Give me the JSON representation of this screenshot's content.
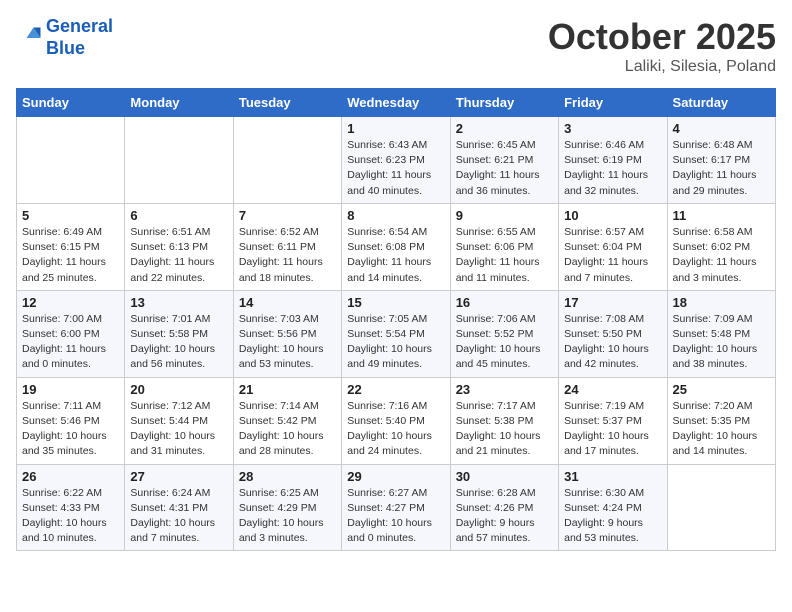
{
  "header": {
    "logo_line1": "General",
    "logo_line2": "Blue",
    "month": "October 2025",
    "location": "Laliki, Silesia, Poland"
  },
  "weekdays": [
    "Sunday",
    "Monday",
    "Tuesday",
    "Wednesday",
    "Thursday",
    "Friday",
    "Saturday"
  ],
  "weeks": [
    [
      {
        "day": "",
        "sunrise": "",
        "sunset": "",
        "daylight": ""
      },
      {
        "day": "",
        "sunrise": "",
        "sunset": "",
        "daylight": ""
      },
      {
        "day": "",
        "sunrise": "",
        "sunset": "",
        "daylight": ""
      },
      {
        "day": "1",
        "sunrise": "Sunrise: 6:43 AM",
        "sunset": "Sunset: 6:23 PM",
        "daylight": "Daylight: 11 hours and 40 minutes."
      },
      {
        "day": "2",
        "sunrise": "Sunrise: 6:45 AM",
        "sunset": "Sunset: 6:21 PM",
        "daylight": "Daylight: 11 hours and 36 minutes."
      },
      {
        "day": "3",
        "sunrise": "Sunrise: 6:46 AM",
        "sunset": "Sunset: 6:19 PM",
        "daylight": "Daylight: 11 hours and 32 minutes."
      },
      {
        "day": "4",
        "sunrise": "Sunrise: 6:48 AM",
        "sunset": "Sunset: 6:17 PM",
        "daylight": "Daylight: 11 hours and 29 minutes."
      }
    ],
    [
      {
        "day": "5",
        "sunrise": "Sunrise: 6:49 AM",
        "sunset": "Sunset: 6:15 PM",
        "daylight": "Daylight: 11 hours and 25 minutes."
      },
      {
        "day": "6",
        "sunrise": "Sunrise: 6:51 AM",
        "sunset": "Sunset: 6:13 PM",
        "daylight": "Daylight: 11 hours and 22 minutes."
      },
      {
        "day": "7",
        "sunrise": "Sunrise: 6:52 AM",
        "sunset": "Sunset: 6:11 PM",
        "daylight": "Daylight: 11 hours and 18 minutes."
      },
      {
        "day": "8",
        "sunrise": "Sunrise: 6:54 AM",
        "sunset": "Sunset: 6:08 PM",
        "daylight": "Daylight: 11 hours and 14 minutes."
      },
      {
        "day": "9",
        "sunrise": "Sunrise: 6:55 AM",
        "sunset": "Sunset: 6:06 PM",
        "daylight": "Daylight: 11 hours and 11 minutes."
      },
      {
        "day": "10",
        "sunrise": "Sunrise: 6:57 AM",
        "sunset": "Sunset: 6:04 PM",
        "daylight": "Daylight: 11 hours and 7 minutes."
      },
      {
        "day": "11",
        "sunrise": "Sunrise: 6:58 AM",
        "sunset": "Sunset: 6:02 PM",
        "daylight": "Daylight: 11 hours and 3 minutes."
      }
    ],
    [
      {
        "day": "12",
        "sunrise": "Sunrise: 7:00 AM",
        "sunset": "Sunset: 6:00 PM",
        "daylight": "Daylight: 11 hours and 0 minutes."
      },
      {
        "day": "13",
        "sunrise": "Sunrise: 7:01 AM",
        "sunset": "Sunset: 5:58 PM",
        "daylight": "Daylight: 10 hours and 56 minutes."
      },
      {
        "day": "14",
        "sunrise": "Sunrise: 7:03 AM",
        "sunset": "Sunset: 5:56 PM",
        "daylight": "Daylight: 10 hours and 53 minutes."
      },
      {
        "day": "15",
        "sunrise": "Sunrise: 7:05 AM",
        "sunset": "Sunset: 5:54 PM",
        "daylight": "Daylight: 10 hours and 49 minutes."
      },
      {
        "day": "16",
        "sunrise": "Sunrise: 7:06 AM",
        "sunset": "Sunset: 5:52 PM",
        "daylight": "Daylight: 10 hours and 45 minutes."
      },
      {
        "day": "17",
        "sunrise": "Sunrise: 7:08 AM",
        "sunset": "Sunset: 5:50 PM",
        "daylight": "Daylight: 10 hours and 42 minutes."
      },
      {
        "day": "18",
        "sunrise": "Sunrise: 7:09 AM",
        "sunset": "Sunset: 5:48 PM",
        "daylight": "Daylight: 10 hours and 38 minutes."
      }
    ],
    [
      {
        "day": "19",
        "sunrise": "Sunrise: 7:11 AM",
        "sunset": "Sunset: 5:46 PM",
        "daylight": "Daylight: 10 hours and 35 minutes."
      },
      {
        "day": "20",
        "sunrise": "Sunrise: 7:12 AM",
        "sunset": "Sunset: 5:44 PM",
        "daylight": "Daylight: 10 hours and 31 minutes."
      },
      {
        "day": "21",
        "sunrise": "Sunrise: 7:14 AM",
        "sunset": "Sunset: 5:42 PM",
        "daylight": "Daylight: 10 hours and 28 minutes."
      },
      {
        "day": "22",
        "sunrise": "Sunrise: 7:16 AM",
        "sunset": "Sunset: 5:40 PM",
        "daylight": "Daylight: 10 hours and 24 minutes."
      },
      {
        "day": "23",
        "sunrise": "Sunrise: 7:17 AM",
        "sunset": "Sunset: 5:38 PM",
        "daylight": "Daylight: 10 hours and 21 minutes."
      },
      {
        "day": "24",
        "sunrise": "Sunrise: 7:19 AM",
        "sunset": "Sunset: 5:37 PM",
        "daylight": "Daylight: 10 hours and 17 minutes."
      },
      {
        "day": "25",
        "sunrise": "Sunrise: 7:20 AM",
        "sunset": "Sunset: 5:35 PM",
        "daylight": "Daylight: 10 hours and 14 minutes."
      }
    ],
    [
      {
        "day": "26",
        "sunrise": "Sunrise: 6:22 AM",
        "sunset": "Sunset: 4:33 PM",
        "daylight": "Daylight: 10 hours and 10 minutes."
      },
      {
        "day": "27",
        "sunrise": "Sunrise: 6:24 AM",
        "sunset": "Sunset: 4:31 PM",
        "daylight": "Daylight: 10 hours and 7 minutes."
      },
      {
        "day": "28",
        "sunrise": "Sunrise: 6:25 AM",
        "sunset": "Sunset: 4:29 PM",
        "daylight": "Daylight: 10 hours and 3 minutes."
      },
      {
        "day": "29",
        "sunrise": "Sunrise: 6:27 AM",
        "sunset": "Sunset: 4:27 PM",
        "daylight": "Daylight: 10 hours and 0 minutes."
      },
      {
        "day": "30",
        "sunrise": "Sunrise: 6:28 AM",
        "sunset": "Sunset: 4:26 PM",
        "daylight": "Daylight: 9 hours and 57 minutes."
      },
      {
        "day": "31",
        "sunrise": "Sunrise: 6:30 AM",
        "sunset": "Sunset: 4:24 PM",
        "daylight": "Daylight: 9 hours and 53 minutes."
      },
      {
        "day": "",
        "sunrise": "",
        "sunset": "",
        "daylight": ""
      }
    ]
  ]
}
